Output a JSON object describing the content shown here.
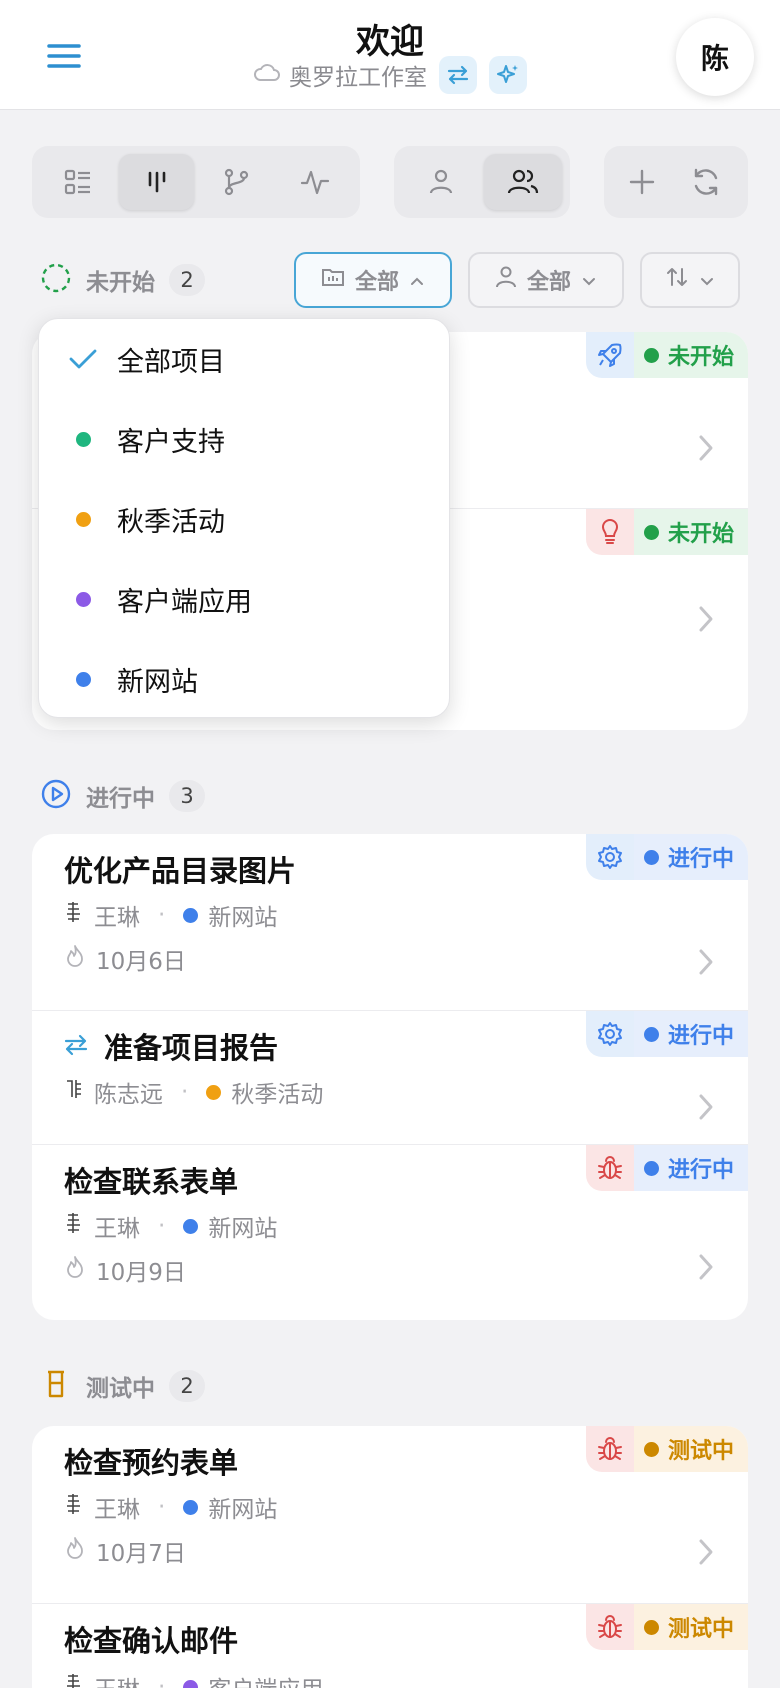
{
  "header": {
    "title": "欢迎",
    "workspace": "奥罗拉工作室",
    "avatar_initial": "陈"
  },
  "toolbar": {
    "view_icons": [
      "list-icon",
      "board-icon",
      "branch-icon",
      "activity-icon"
    ],
    "active_view": "board-icon",
    "scope_icons": [
      "user-icon",
      "users-icon"
    ],
    "active_scope": "users-icon",
    "action_icons": [
      "plus-icon",
      "refresh-icon"
    ]
  },
  "filters": {
    "project_label": "全部",
    "assignee_label": "全部"
  },
  "dropdown": {
    "items": [
      {
        "label": "全部项目",
        "selected": true,
        "color": "#3a9fd6"
      },
      {
        "label": "客户支持",
        "selected": false,
        "color": "#1fb67f"
      },
      {
        "label": "秋季活动",
        "selected": false,
        "color": "#f0a012"
      },
      {
        "label": "客户端应用",
        "selected": false,
        "color": "#8c5ae6"
      },
      {
        "label": "新网站",
        "selected": false,
        "color": "#3f80ea"
      }
    ]
  },
  "sections": [
    {
      "label": "未开始",
      "count": "2",
      "color": "#22a04a",
      "cards": [
        {
          "status": "未开始",
          "status_icon": "rocket-icon"
        },
        {
          "status": "未开始",
          "status_icon": "lightbulb-icon"
        }
      ]
    },
    {
      "label": "进行中",
      "count": "3",
      "color": "#3f80ea",
      "cards": [
        {
          "title": "优化产品目录图片",
          "assignee": "王琳",
          "project": "新网站",
          "date": "10月6日",
          "status": "进行中",
          "status_icon": "gear-icon"
        },
        {
          "title": "准备项目报告",
          "assignee": "陈志远",
          "project": "秋季活动",
          "status": "进行中",
          "status_icon": "gear-icon"
        },
        {
          "title": "检查联系表单",
          "assignee": "王琳",
          "project": "新网站",
          "date": "10月9日",
          "status": "进行中",
          "status_icon": "bug-icon"
        }
      ]
    },
    {
      "label": "测试中",
      "count": "2",
      "color": "#cc8800",
      "cards": [
        {
          "title": "检查预约表单",
          "assignee": "王琳",
          "project": "新网站",
          "date": "10月7日",
          "status": "测试中",
          "status_icon": "bug-icon"
        },
        {
          "title": "检查确认邮件",
          "assignee": "王琳",
          "project": "客户端应用",
          "status": "测试中",
          "status_icon": "bug-icon"
        }
      ]
    }
  ],
  "colors": {
    "accent": "#3a9fd6",
    "not_started": "#22a04a",
    "in_progress": "#3f80ea",
    "testing": "#cc8800",
    "autumn": "#f0a012",
    "client_app": "#8c5ae6"
  }
}
